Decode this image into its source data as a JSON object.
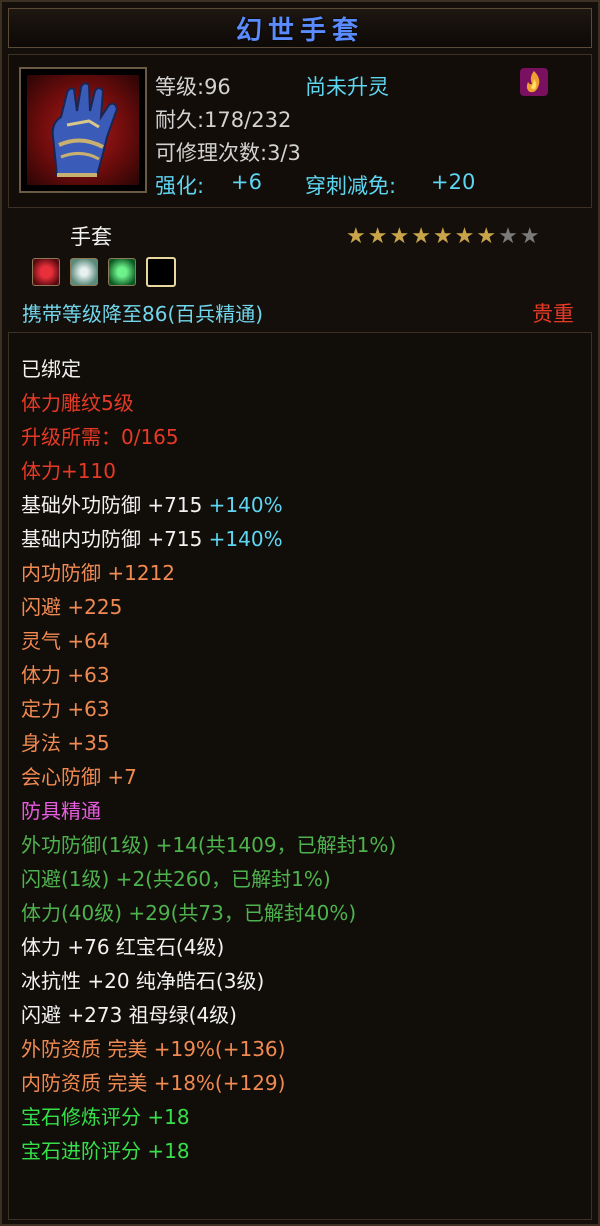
{
  "title": "幻世手套",
  "item": {
    "level": "等级:96",
    "soul_status": "尚未升灵",
    "durability": "耐久:178/232",
    "repair": "可修理次数:3/3",
    "enhance_label": "强化:",
    "enhance_value": "+6",
    "pierce_label": "穿刺减免:",
    "pierce_value": "+20",
    "type": "手套",
    "stars_filled": 7,
    "stars_total": 9,
    "carry_level": "携带等级降至86(百兵精通)",
    "rarity": "贵重"
  },
  "icons": {
    "item_icon": "glove-icon",
    "soul_icon": "flame-icon",
    "gem_slots": [
      "red-gem-icon",
      "white-gem-icon",
      "green-gem-icon",
      "empty-slot-icon"
    ]
  },
  "colors": {
    "title": "#5b8cff",
    "cyan": "#5ed6f2",
    "red": "#e63a26",
    "orange": "#f08a52",
    "pink": "#e85ce0",
    "green": "#4eb24e",
    "bright_green": "#35e04a",
    "gold_star": "#c9a44a",
    "grey_star": "#7a7a7a"
  },
  "bound": "已绑定",
  "carve": {
    "name": "体力雕纹5级",
    "upgrade": "升级所需：0/165",
    "bonus": "体力+110"
  },
  "base_stats": [
    {
      "label": "基础外功防御 +715",
      "pct": "+140%"
    },
    {
      "label": "基础内功防御 +715",
      "pct": "+140%"
    }
  ],
  "stats": [
    "内功防御 +1212",
    "闪避 +225",
    "灵气 +64",
    "体力 +63",
    "定力 +63",
    "身法 +35",
    "会心防御 +7"
  ],
  "mastery": {
    "title": "防具精通",
    "lines": [
      "外功防御(1级) +14(共1409，已解封1%)",
      "闪避(1级) +2(共260，已解封1%)",
      "体力(40级) +29(共73，已解封40%)"
    ]
  },
  "gems": [
    "体力 +76 红宝石(4级)",
    "冰抗性 +20 纯净皓石(3级)",
    "闪避 +273 祖母绿(4级)"
  ],
  "quality": [
    "外防资质  完美 +19%(+136)",
    "内防资质  完美 +18%(+129)"
  ],
  "scores": [
    "宝石修炼评分 +18",
    "宝石进阶评分 +18"
  ]
}
